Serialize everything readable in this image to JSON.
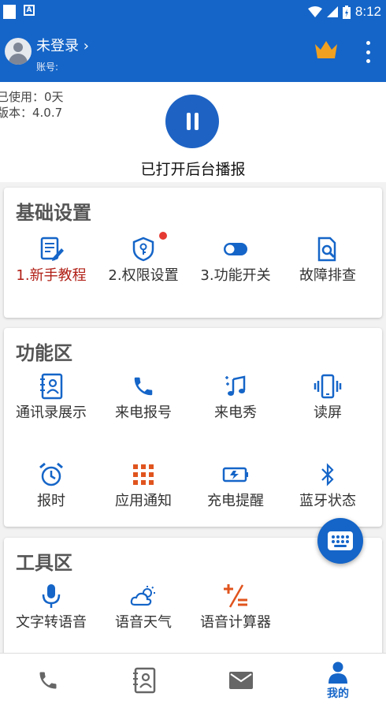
{
  "statusbar": {
    "time": "8:12"
  },
  "header": {
    "username": "未登录 ›",
    "account": "账号:",
    "crown_icon": "crown-icon",
    "menu_icon": "more-vert-icon",
    "colors": {
      "primary": "#1565c8",
      "crown": "#f0a020"
    }
  },
  "status": {
    "used": "已使用：0天",
    "version": "版本：4.0.7",
    "broadcast": "已打开后台播报"
  },
  "basic": {
    "title": "基础设置",
    "items": [
      {
        "label": "1.新手教程",
        "icon": "tutorial-icon"
      },
      {
        "label": "2.权限设置",
        "icon": "permission-shield-icon"
      },
      {
        "label": "3.功能开关",
        "icon": "toggle-icon"
      },
      {
        "label": "故障排查",
        "icon": "troubleshoot-icon"
      }
    ]
  },
  "features": {
    "title": "功能区",
    "items": [
      {
        "label": "通讯录展示",
        "icon": "contacts-icon"
      },
      {
        "label": "来电报号",
        "icon": "phone-icon"
      },
      {
        "label": "来电秀",
        "icon": "music-icon"
      },
      {
        "label": "读屏",
        "icon": "phone-vibrate-icon"
      },
      {
        "label": "报时",
        "icon": "alarm-clock-icon"
      },
      {
        "label": "应用通知",
        "icon": "apps-grid-icon"
      },
      {
        "label": "充电提醒",
        "icon": "battery-charging-icon"
      },
      {
        "label": "蓝牙状态",
        "icon": "bluetooth-icon"
      }
    ]
  },
  "tools": {
    "title": "工具区",
    "items": [
      {
        "label": "文字转语音",
        "icon": "microphone-icon"
      },
      {
        "label": "语音天气",
        "icon": "weather-icon"
      },
      {
        "label": "语音计算器",
        "icon": "calculator-icon"
      }
    ]
  },
  "bottom_nav": {
    "items": [
      {
        "label": "",
        "icon": "phone-icon"
      },
      {
        "label": "",
        "icon": "contacts-icon"
      },
      {
        "label": "",
        "icon": "mail-icon"
      },
      {
        "label": "我的",
        "icon": "person-icon",
        "active": true
      }
    ]
  }
}
